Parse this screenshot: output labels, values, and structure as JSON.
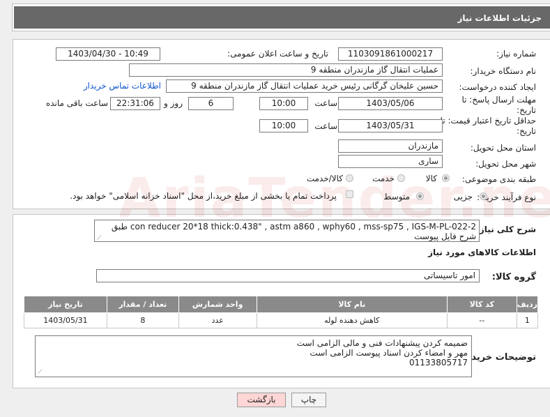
{
  "header": {
    "title": "جزئیات اطلاعات نیاز"
  },
  "form": {
    "need_number": {
      "label": "شماره نیاز:",
      "value": "1103091861000217"
    },
    "announce_datetime": {
      "label": "تاریخ و ساعت اعلان عمومی:",
      "value": "1403/04/30 - 10:49"
    },
    "buyer_org": {
      "label": "نام دستگاه خریدار:",
      "value": "عملیات انتقال گاز مازندران منطقه 9"
    },
    "requester": {
      "label": "ایجاد کننده درخواست:",
      "value": "حسین علیخان گرگانی رئیس خرید عملیات انتقال گاز مازندران منطقه 9",
      "contact_link": "اطلاعات تماس خریدار"
    },
    "reply_deadline": {
      "label_line1": "مهلت ارسال پاسخ: تا",
      "label_line2": "تاریخ:",
      "date": "1403/05/06",
      "time_label": "ساعت",
      "time": "10:00",
      "days": "6",
      "days_label": "روز و",
      "remaining": "22:31:06",
      "remaining_label": "ساعت باقی مانده"
    },
    "price_validity": {
      "label_line1": "حداقل تاریخ اعتبار قیمت: تا",
      "label_line2": "تاریخ:",
      "date": "1403/05/31",
      "time_label": "ساعت",
      "time": "10:00"
    },
    "province": {
      "label": "استان محل تحویل:",
      "value": "مازندران"
    },
    "city": {
      "label": "شهر محل تحویل:",
      "value": "ساری"
    },
    "category": {
      "label": "طبقه بندی موضوعی:",
      "options": [
        "کالا",
        "خدمت",
        "کالا/خدمت"
      ],
      "selected": "کالا"
    },
    "purchase_type": {
      "label": "نوع فرآیند خرید :",
      "options": [
        "جزیی",
        "متوسط"
      ],
      "selected": "جزیی",
      "treasury_note": "پرداخت تمام یا بخشی از مبلغ خرید،از محل \"اسناد خزانه اسلامی\" خواهد بود."
    }
  },
  "description": {
    "label": "شرح کلی نیاز:",
    "value": "con reducer 20*18 thick:0.438\" , astm a860 , wphy60 , mss-sp75 , IGS-M-PL-022-2 طبق شرح فایل پیوست"
  },
  "goods_section": {
    "title": "اطلاعات کالاهای مورد نیاز",
    "group_label": "گروه کالا:",
    "group_value": "امور تاسیساتی"
  },
  "goods_table": {
    "headers": [
      "ردیف",
      "کد کالا",
      "نام کالا",
      "واحد شمارش",
      "تعداد / مقدار",
      "تاریخ نیاز"
    ],
    "rows": [
      [
        "1",
        "--",
        "کاهش دهنده لوله",
        "عدد",
        "8",
        "1403/05/31"
      ]
    ]
  },
  "buyer_notes": {
    "label": "توضیحات خریدار:",
    "lines": [
      "ضمیمه کردن پیشنهادات فنی و مالی الزامی است",
      "مهر و امضاء کردن اسناد پیوست الزامی است",
      "01133805717"
    ]
  },
  "buttons": {
    "print": "چاپ",
    "back": "بازگشت"
  },
  "watermark": "AriaTender.neT",
  "colors": {
    "header_bg": "#686868",
    "table_header_bg": "#8a8a8a",
    "link": "#1155cc",
    "back_button_bg": "#ffd6d6"
  }
}
